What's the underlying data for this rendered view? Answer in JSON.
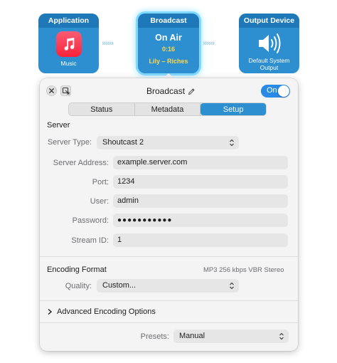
{
  "chain": {
    "application": {
      "title": "Application",
      "name": "Music"
    },
    "broadcast": {
      "title": "Broadcast",
      "status": "On Air",
      "time": "0:16",
      "track": "Lily – Riches"
    },
    "output": {
      "title": "Output Device",
      "name_line1": "Default System",
      "name_line2": "Output"
    },
    "connector": "››››››"
  },
  "panel": {
    "title": "Broadcast",
    "toggle_label": "On",
    "tabs": [
      "Status",
      "Metadata",
      "Setup"
    ],
    "active_tab": "Setup",
    "server": {
      "heading": "Server",
      "type_label": "Server Type:",
      "type_value": "Shoutcast 2",
      "address_label": "Server Address:",
      "address_value": "example.server.com",
      "port_label": "Port:",
      "port_value": "1234",
      "user_label": "User:",
      "user_value": "admin",
      "password_label": "Password:",
      "password_value": "●●●●●●●●●●●",
      "stream_label": "Stream ID:",
      "stream_value": "1"
    },
    "encoding": {
      "heading": "Encoding Format",
      "summary": "MP3 256 kbps VBR Stereo",
      "quality_label": "Quality:",
      "quality_value": "Custom...",
      "advanced_label": "Advanced Encoding Options"
    },
    "presets": {
      "label": "Presets:",
      "value": "Manual"
    }
  },
  "colors": {
    "accent": "#2d8fd0",
    "toggle": "#2a8be6",
    "highlight_text": "#ffd84a"
  }
}
